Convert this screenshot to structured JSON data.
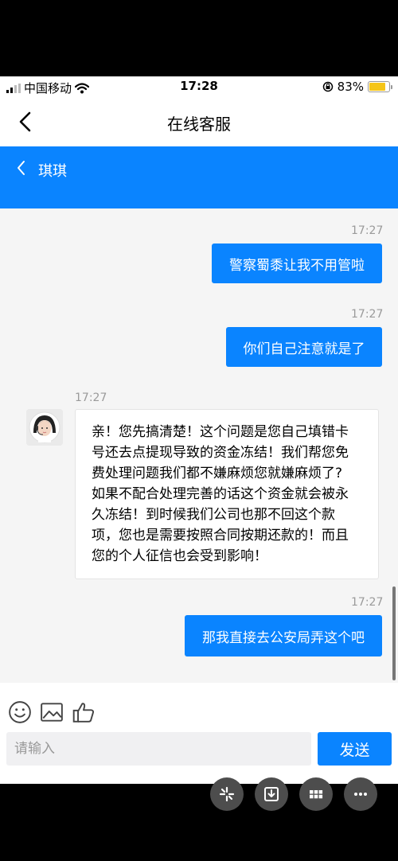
{
  "status": {
    "carrier": "中国移动",
    "time": "17:28",
    "battery": "83%",
    "battery_level": 0.83
  },
  "nav": {
    "back_label": "‹",
    "title": "在线客服"
  },
  "agent": {
    "back_label": "‹",
    "name": "琪琪"
  },
  "messages": [
    {
      "time": "17:27",
      "direction": "out",
      "text": "警察蜀黍让我不用管啦"
    },
    {
      "time": "17:27",
      "direction": "out",
      "text": "你们自己注意就是了"
    },
    {
      "time": "17:27",
      "direction": "in",
      "lines": [
        "亲！您先搞清楚！这个问题是您自己填错卡",
        "号还去点提现导致的资金冻结！我们帮您免",
        "费处理问题我们都不嫌麻烦您就嫌麻烦了?",
        "如果不配合处理完善的话这个资金就会被永",
        "久冻结！到时候我们公司也那不回这个款",
        "项，您也是需要按照合同按期还款的！而且",
        "您的个人征信也会受到影响！"
      ]
    },
    {
      "time": "17:27",
      "direction": "out",
      "text": "那我直接去公安局弄这个吧"
    }
  ],
  "composer": {
    "placeholder": "请输入",
    "send_label": "发送"
  },
  "colors": {
    "accent": "#0a84ff",
    "chat_bg": "#f5f5f5",
    "battery": "#f5c518"
  }
}
